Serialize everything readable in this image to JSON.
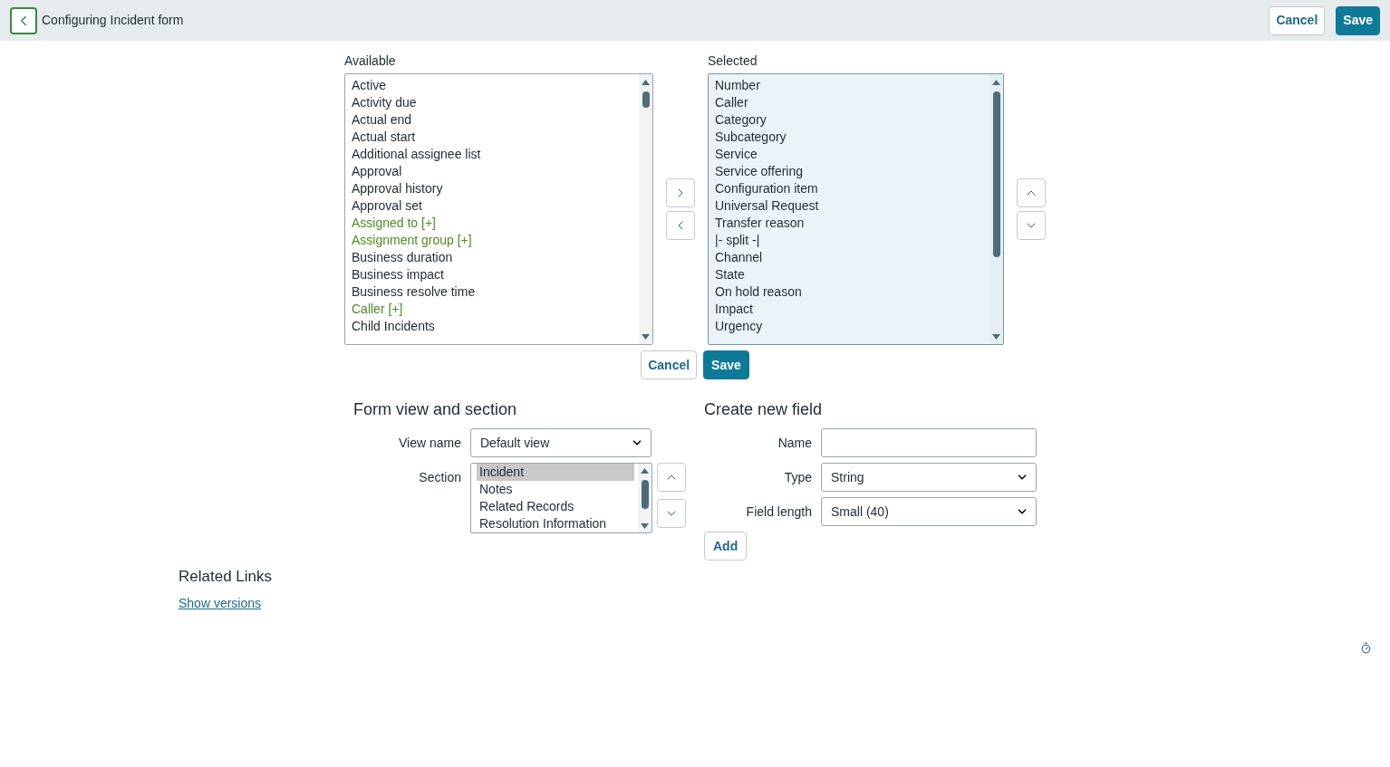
{
  "header": {
    "title": "Configuring Incident form",
    "buttons": [
      {
        "label": "Cancel",
        "kind": "secondary"
      },
      {
        "label": "Save",
        "kind": "primary"
      }
    ]
  },
  "slushbucket": {
    "available": {
      "label": "Available",
      "items": [
        {
          "label": "Active",
          "kind": "field",
          "selected": false
        },
        {
          "label": "Activity due",
          "kind": "field",
          "selected": false
        },
        {
          "label": "Actual end",
          "kind": "field",
          "selected": false
        },
        {
          "label": "Actual start",
          "kind": "field",
          "selected": false
        },
        {
          "label": "Additional assignee list",
          "kind": "field",
          "selected": false
        },
        {
          "label": "Approval",
          "kind": "field",
          "selected": false
        },
        {
          "label": "Approval history",
          "kind": "field",
          "selected": false
        },
        {
          "label": "Approval set",
          "kind": "field",
          "selected": false
        },
        {
          "label": "Assigned to [+]",
          "kind": "reference",
          "selected": false
        },
        {
          "label": "Assignment group [+]",
          "kind": "reference",
          "selected": false
        },
        {
          "label": "Business duration",
          "kind": "field",
          "selected": false
        },
        {
          "label": "Business impact",
          "kind": "field",
          "selected": false
        },
        {
          "label": "Business resolve time",
          "kind": "field",
          "selected": false
        },
        {
          "label": "Caller [+]",
          "kind": "reference",
          "selected": false
        },
        {
          "label": "Child Incidents",
          "kind": "field",
          "selected": false
        }
      ]
    },
    "selected": {
      "label": "Selected",
      "items": [
        {
          "label": "Number",
          "selected": false
        },
        {
          "label": "Caller",
          "selected": false
        },
        {
          "label": "Category",
          "selected": false
        },
        {
          "label": "Subcategory",
          "selected": false
        },
        {
          "label": "Service",
          "selected": false
        },
        {
          "label": "Service offering",
          "selected": false
        },
        {
          "label": "Configuration item",
          "selected": false
        },
        {
          "label": "Universal Request",
          "selected": false
        },
        {
          "label": "Transfer reason",
          "selected": false
        },
        {
          "label": "|- split -|",
          "selected": false
        },
        {
          "label": "Channel",
          "selected": false
        },
        {
          "label": "State",
          "selected": false
        },
        {
          "label": "On hold reason",
          "selected": false
        },
        {
          "label": "Impact",
          "selected": false
        },
        {
          "label": "Urgency",
          "selected": false
        }
      ]
    },
    "buttons": [
      {
        "label": "Cancel",
        "kind": "secondary"
      },
      {
        "label": "Save",
        "kind": "primary"
      }
    ]
  },
  "form_view": {
    "title": "Form view and section",
    "view_name": {
      "label": "View name",
      "value": "Default view"
    },
    "section": {
      "label": "Section",
      "items": [
        {
          "label": "Incident",
          "selected": true
        },
        {
          "label": "Notes",
          "selected": false
        },
        {
          "label": "Related Records",
          "selected": false
        },
        {
          "label": "Resolution Information",
          "selected": false
        }
      ]
    }
  },
  "new_field": {
    "title": "Create new field",
    "name": {
      "label": "Name"
    },
    "type": {
      "label": "Type",
      "value": "String"
    },
    "field_length": {
      "label": "Field length",
      "value": "Small (40)"
    },
    "add_button": "Add"
  },
  "related_links": {
    "title": "Related Links",
    "links": [
      "Show versions"
    ]
  }
}
